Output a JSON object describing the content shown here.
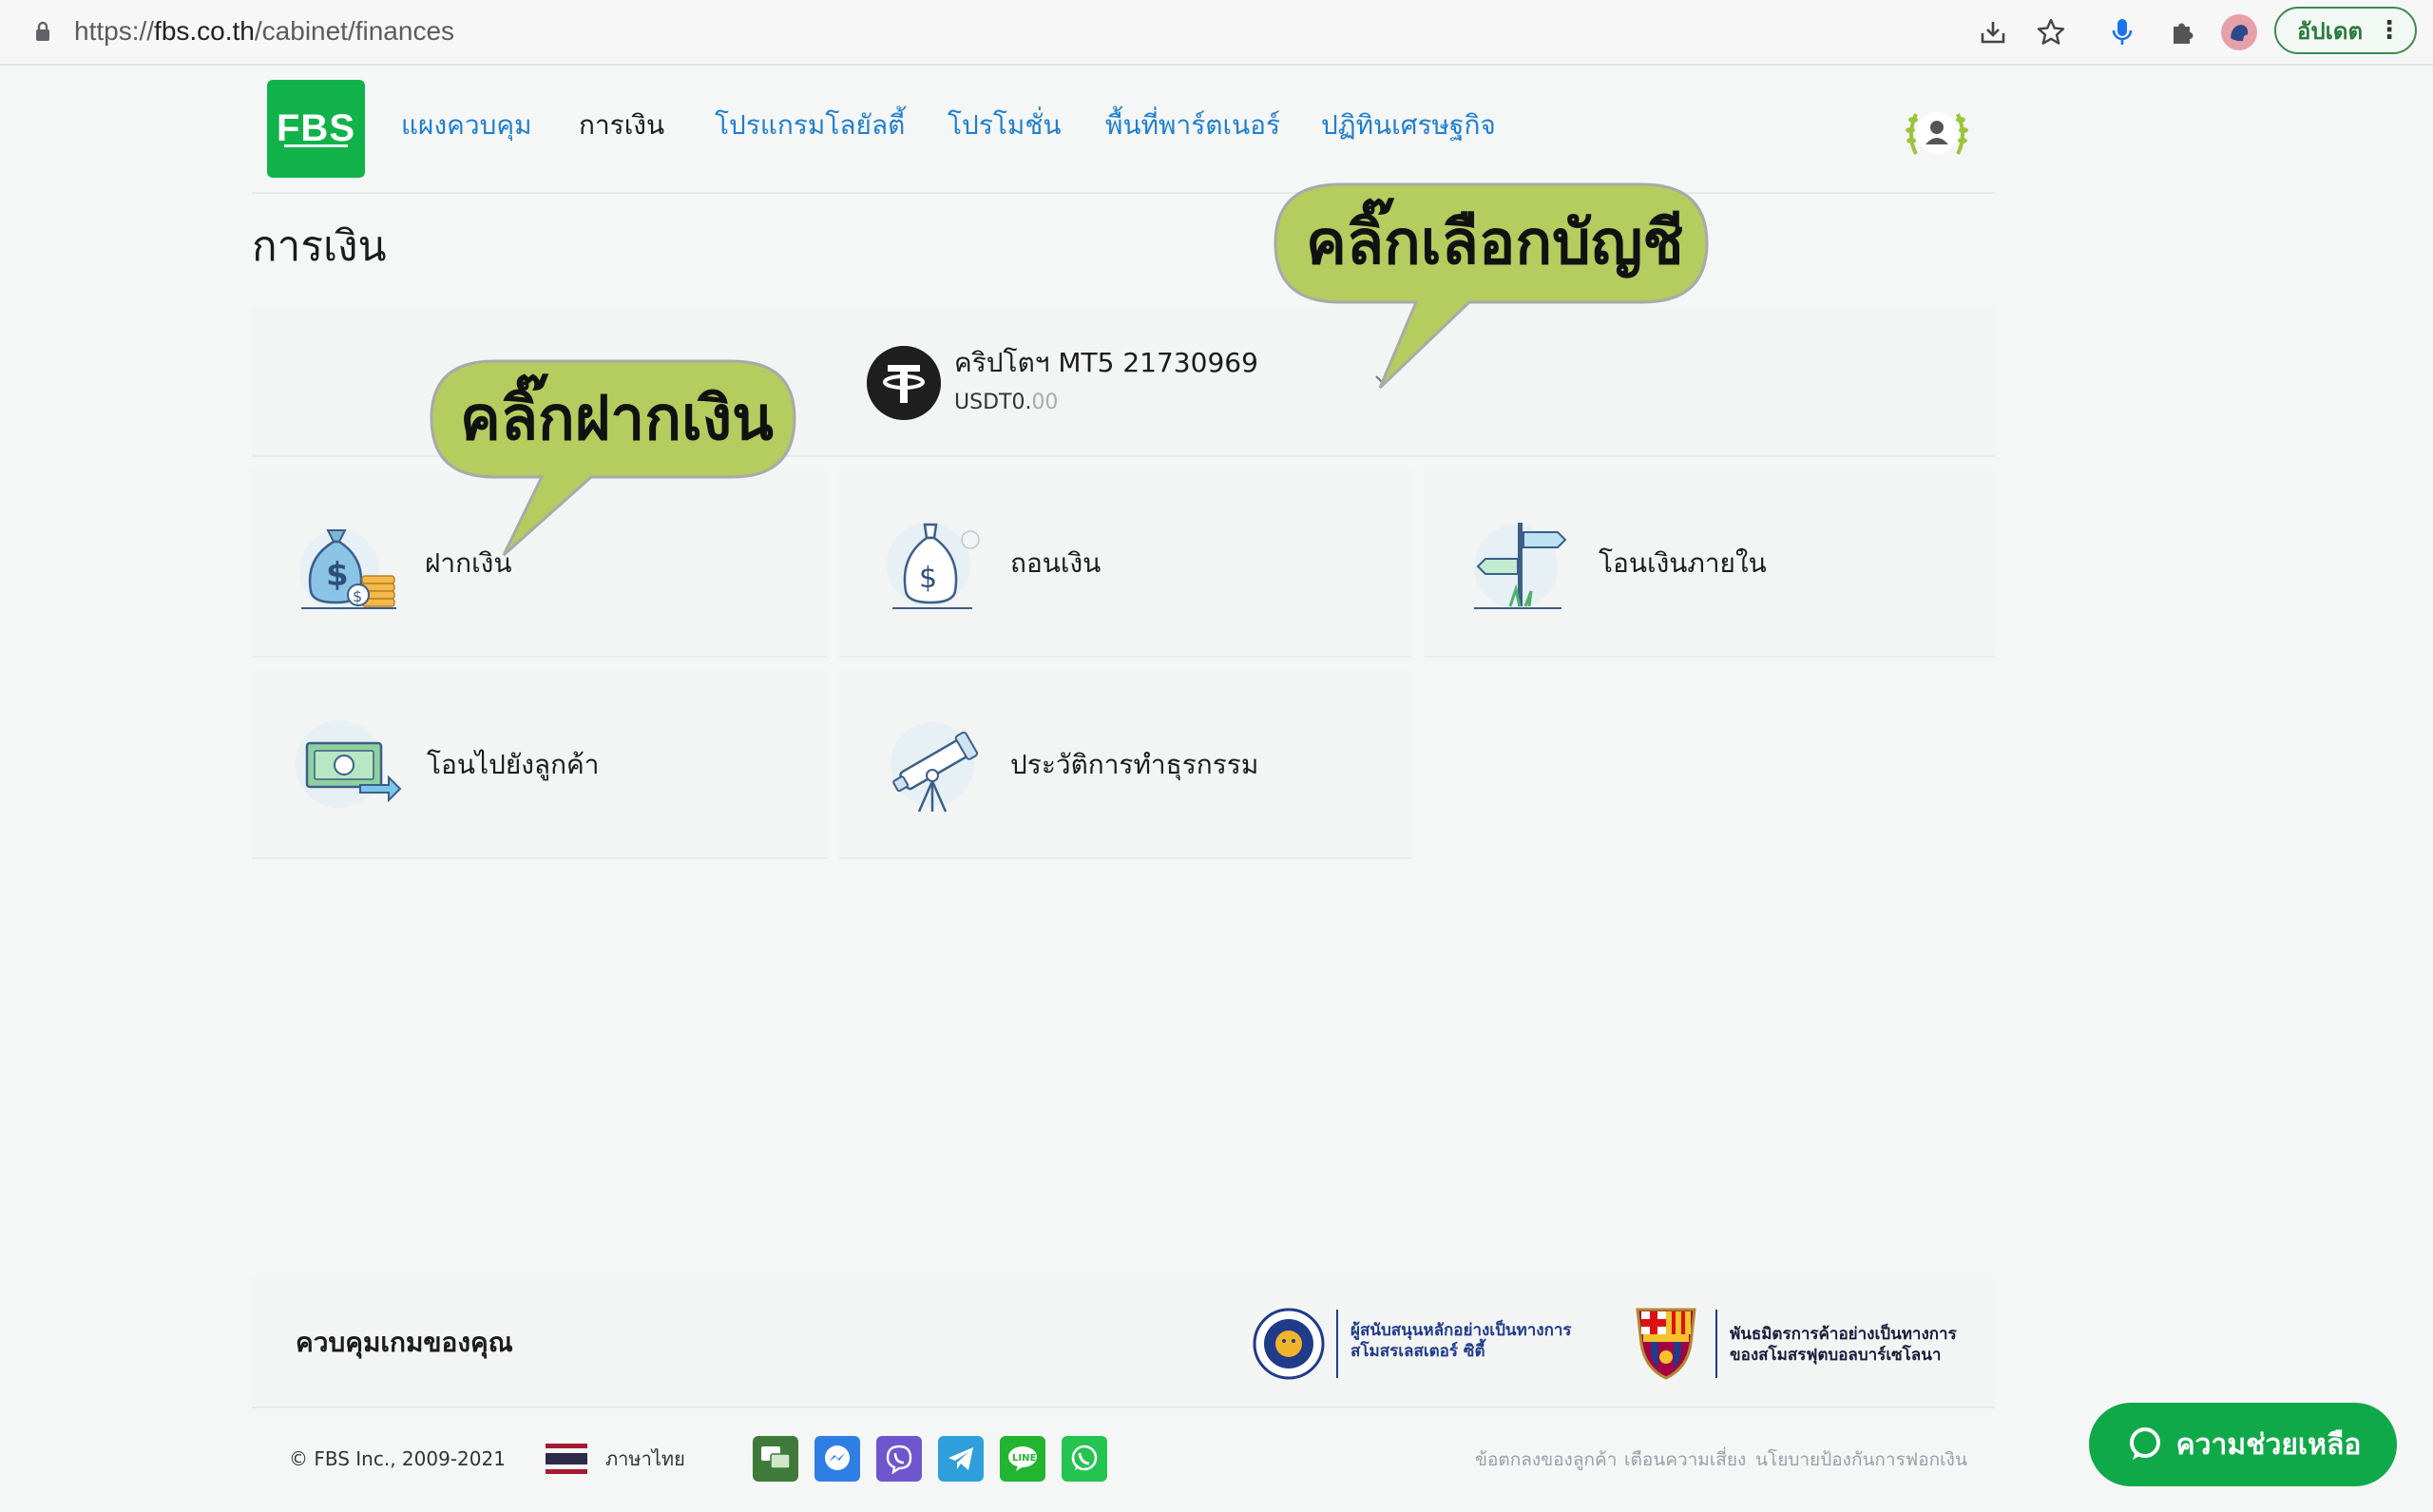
{
  "browser": {
    "url_prefix": "https://",
    "url_domain": "fbs.co.th",
    "url_path": "/cabinet/finances",
    "update_label": "อัปเดต",
    "menu_glyph": "⋮"
  },
  "header": {
    "logo_text": "FBS",
    "nav": [
      "แผงควบคุม",
      "การเงิน",
      "โปรแกรมโลยัลตี้",
      "โปรโมชั่น",
      "พื้นที่พาร์ตเนอร์",
      "ปฏิทินเศรษฐกิจ"
    ],
    "active_index": 1
  },
  "page": {
    "title": "การเงิน"
  },
  "account": {
    "name": "คริปโตฯ  MT5 21730969",
    "balance_main": "USDT0.",
    "balance_cents": "00"
  },
  "tiles": [
    {
      "label": "ฝากเงิน",
      "icon": "money-bag-coins-icon"
    },
    {
      "label": "ถอนเงิน",
      "icon": "money-bag-icon"
    },
    {
      "label": "โอนเงินภายใน",
      "icon": "signpost-icon"
    },
    {
      "label": "โอนไปยังลูกค้า",
      "icon": "banknote-transfer-icon"
    },
    {
      "label": "ประวัติการทำธุรกรรม",
      "icon": "telescope-icon"
    }
  ],
  "callouts": {
    "deposit": "คลิ๊กฝากเงิน",
    "account": "คลิ๊กเลือกบัญชี"
  },
  "footer": {
    "title": "ควบคุมเกมของคุณ",
    "sponsor1_line1": "ผู้สนับสนุนหลักอย่างเป็นทางการ",
    "sponsor1_line2": "สโมสรเลสเตอร์ ซิตี้",
    "sponsor2_line1": "พันธมิตรการค้าอย่างเป็นทางการ",
    "sponsor2_line2": "ของสโมสรฟุตบอลบาร์เซโลนา",
    "copyright": "© FBS Inc., 2009-2021",
    "language": "ภาษาไทย",
    "links": [
      "ข้อตกลงของลูกค้า",
      "เตือนความเสี่ยง",
      "นโยบายป้องกันการฟอกเงิน"
    ],
    "social": [
      "livechat-icon",
      "messenger-icon",
      "viber-icon",
      "telegram-icon",
      "line-icon",
      "whatsapp-icon"
    ]
  },
  "help": {
    "label": "ความช่วยเหลือ"
  },
  "colors": {
    "brand_green": "#11b24a",
    "link_blue": "#1f7fcf",
    "callout_green": "#b5cc5f",
    "help_green": "#10a94a"
  }
}
